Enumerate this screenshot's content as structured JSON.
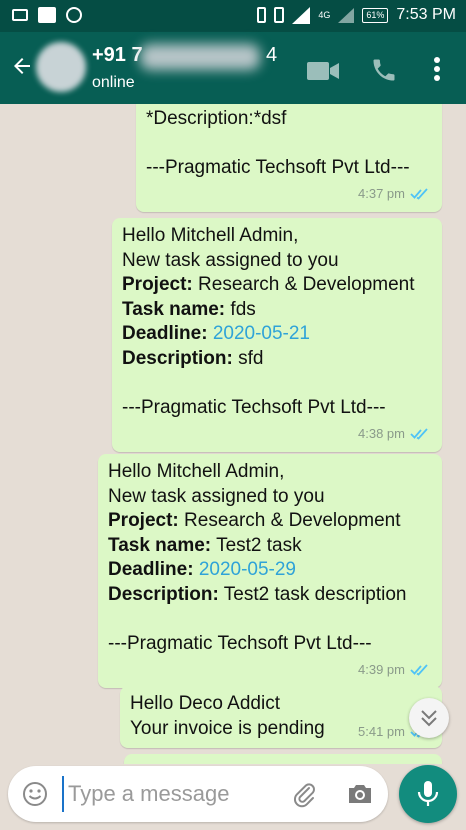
{
  "status_bar": {
    "network_type": "4G",
    "battery": "61%",
    "time": "7:53 PM"
  },
  "header": {
    "contact_name_visible": "+91 7",
    "contact_name_tail": "4",
    "presence": "online"
  },
  "messages": [
    {
      "lines": [
        {
          "type": "plain",
          "text": "*Description:*dsf"
        },
        {
          "type": "blank"
        },
        {
          "type": "plain",
          "text": "---Pragmatic Techsoft Pvt Ltd---"
        }
      ],
      "time": "4:37 pm",
      "status": "read"
    },
    {
      "lines": [
        {
          "type": "plain",
          "text": "Hello Mitchell Admin,"
        },
        {
          "type": "plain",
          "text": "New task assigned to you"
        },
        {
          "type": "field",
          "label": "Project:",
          "value": "Research & Development"
        },
        {
          "type": "field",
          "label": "Task name:",
          "value": "fds"
        },
        {
          "type": "field",
          "label": "Deadline:",
          "value": "2020-05-21",
          "link": true
        },
        {
          "type": "field",
          "label": "Description:",
          "value": "sfd"
        },
        {
          "type": "blank"
        },
        {
          "type": "plain",
          "text": "---Pragmatic Techsoft Pvt Ltd---"
        }
      ],
      "time": "4:38 pm",
      "status": "read"
    },
    {
      "lines": [
        {
          "type": "plain",
          "text": "Hello Mitchell Admin,"
        },
        {
          "type": "plain",
          "text": "New task assigned to you"
        },
        {
          "type": "field",
          "label": "Project:",
          "value": "Research & Development"
        },
        {
          "type": "field",
          "label": "Task name:",
          "value": "Test2 task"
        },
        {
          "type": "field",
          "label": "Deadline:",
          "value": "2020-05-29",
          "link": true
        },
        {
          "type": "field",
          "label": "Description:",
          "value": "Test2 task description"
        },
        {
          "type": "blank"
        },
        {
          "type": "plain",
          "text": "---Pragmatic Techsoft Pvt Ltd---"
        }
      ],
      "time": "4:39 pm",
      "status": "read"
    },
    {
      "lines": [
        {
          "type": "plain",
          "text": "Hello Deco Addict"
        },
        {
          "type": "plain",
          "text": "Your invoice is pending"
        }
      ],
      "time": "5:41 pm",
      "status": "read"
    }
  ],
  "composer": {
    "placeholder": "Type a message"
  },
  "colors": {
    "header": "#075e54",
    "status_bar": "#054d44",
    "bubble_out": "#dcf8c6",
    "link": "#2fa3d8",
    "read_ticks": "#4fc3f7",
    "mic_button": "#128c7e"
  }
}
